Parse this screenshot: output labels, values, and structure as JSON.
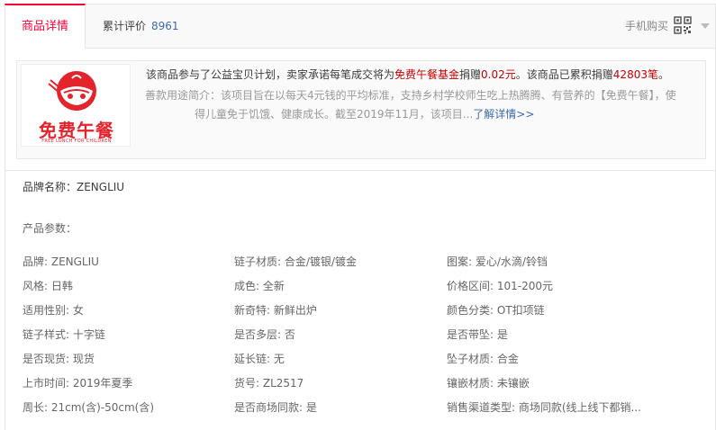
{
  "tabs": {
    "active_label": "商品详情",
    "reviews_label": "累计评价",
    "reviews_count": "8961",
    "mobile_buy": "手机购买"
  },
  "charity": {
    "logo_text": "免费午餐",
    "logo_sub": "FREE LUNCH FOR CHILDREN",
    "line1_prefix": "该商品参与了公益宝贝计划，卖家承诺每笔成交将为",
    "line1_fund": "免费午餐基金",
    "line1_mid": "捐赠",
    "line1_amount": "0.02元",
    "line1_mid2": "。该商品已累积捐赠",
    "line1_total": "42803笔",
    "line1_end": "。",
    "desc_label": "善款用途简介：",
    "desc_line1": "该项目旨在以每天4元钱的平均标准，支持乡村学校师生吃上热腾腾、有营养的【免费午餐】，使",
    "desc_line2": "得儿童免于饥饿、健康成长。截至2019年11月，该项目...",
    "more_link": "了解详情>>"
  },
  "brand_name": "品牌名称：ZENGLIU",
  "params_title": "产品参数：",
  "attributes": [
    [
      "品牌: ZENGLIU",
      "链子材质: 合金/镀银/镀金",
      "图案: 爱心/水滴/铃铛"
    ],
    [
      "风格: 日韩",
      "成色: 全新",
      "价格区间: 101-200元"
    ],
    [
      "适用性别: 女",
      "新奇特: 新鲜出炉",
      "颜色分类: OT扣项链"
    ],
    [
      "链子样式: 十字链",
      "是否多层: 否",
      "是否带坠: 是"
    ],
    [
      "是否现货: 现货",
      "延长链: 无",
      "坠子材质: 合金"
    ],
    [
      "上市时间: 2019年夏季",
      "货号: ZL2517",
      "镶嵌材质: 未镶嵌"
    ],
    [
      "周长: 21cm(含)-50cm(含)",
      "是否商场同款: 是",
      "销售渠道类型: 商场同款(线上线下都销..."
    ]
  ],
  "colors": {
    "accent": "#ff0036",
    "charity_red": "#c40000",
    "link_blue": "#3d6aa8"
  }
}
